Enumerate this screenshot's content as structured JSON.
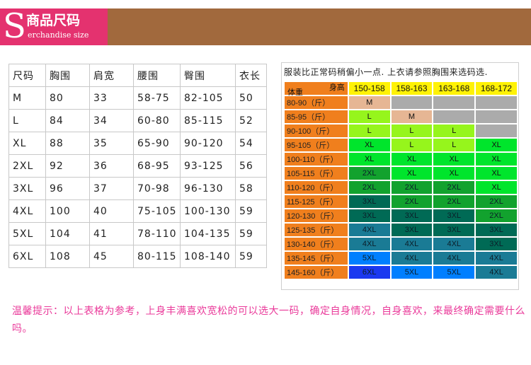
{
  "banner": {
    "letter": "S",
    "title_cn": "商品尺码",
    "title_en": "erchandise size"
  },
  "size_table": {
    "headers": [
      "尺码",
      "胸围",
      "肩宽",
      "腰围",
      "臀围",
      "衣长"
    ],
    "rows": [
      [
        "M",
        "80",
        "33",
        "58-75",
        "82-105",
        "50"
      ],
      [
        "L",
        "84",
        "34",
        "60-80",
        "85-115",
        "52"
      ],
      [
        "XL",
        "88",
        "35",
        "65-90",
        "90-120",
        "54"
      ],
      [
        "2XL",
        "92",
        "36",
        "68-95",
        "93-125",
        "56"
      ],
      [
        "3XL",
        "96",
        "37",
        "70-98",
        "96-130",
        "58"
      ],
      [
        "4XL",
        "100",
        "40",
        "75-105",
        "100-130",
        "59"
      ],
      [
        "5XL",
        "104",
        "41",
        "78-110",
        "104-135",
        "59"
      ],
      [
        "6XL",
        "108",
        "45",
        "80-115",
        "108-140",
        "59"
      ]
    ]
  },
  "recommend": {
    "title": "服装比正常码稍偏小一点. 上衣请参照胸围来选码选.",
    "corner_weight": "体重",
    "corner_height": "身高",
    "heights": [
      "150-158",
      "158-163",
      "163-168",
      "168-172"
    ],
    "rows": [
      {
        "weight": "80-90（斤）",
        "cells": [
          "M",
          "",
          "",
          ""
        ]
      },
      {
        "weight": "85-95（斤）",
        "cells": [
          "L",
          "M",
          "",
          ""
        ]
      },
      {
        "weight": "90-100（斤）",
        "cells": [
          "L",
          "L",
          "L",
          ""
        ]
      },
      {
        "weight": "95-105（斤）",
        "cells": [
          "XL",
          "L",
          "L",
          "XL"
        ]
      },
      {
        "weight": "100-110（斤）",
        "cells": [
          "XL",
          "XL",
          "XL",
          "XL"
        ]
      },
      {
        "weight": "105-115（斤）",
        "cells": [
          "2XL",
          "XL",
          "XL",
          "XL"
        ]
      },
      {
        "weight": "110-120（斤）",
        "cells": [
          "2XL",
          "2XL",
          "2XL",
          "XL"
        ]
      },
      {
        "weight": "115-125（斤）",
        "cells": [
          "3XL",
          "2XL",
          "2XL",
          "2XL"
        ]
      },
      {
        "weight": "120-130（斤）",
        "cells": [
          "3XL",
          "3XL",
          "3XL",
          "2XL"
        ]
      },
      {
        "weight": "125-135（斤）",
        "cells": [
          "4XL",
          "3XL",
          "3XL",
          "3XL"
        ]
      },
      {
        "weight": "130-140（斤）",
        "cells": [
          "4XL",
          "4XL",
          "4XL",
          "3XL"
        ]
      },
      {
        "weight": "135-145（斤）",
        "cells": [
          "5XL",
          "4XL",
          "4XL",
          "4XL"
        ]
      },
      {
        "weight": "145-160（斤）",
        "cells": [
          "6XL",
          "5XL",
          "5XL",
          "4XL"
        ]
      }
    ]
  },
  "colors": {
    "banner_brown": "#a1693d",
    "banner_red": "#e4326f",
    "weight_col": "#f07f1d",
    "header": "#fff205",
    "note": "#ea3a9a",
    "sizes": {
      "empty": "#ababab",
      "M": "#e6b694",
      "L": "#96f51c",
      "XL": "#00e52c",
      "2XL": "#12a22e",
      "3XL": "#006a55",
      "4XL": "#1a7b95",
      "5XL": "#007fff",
      "6XL": "#1b39f0"
    }
  },
  "note": "温馨提示：以上表格为参考，上身丰满喜欢宽松的可以选大一码，确定自身情况，自身喜欢，来最终确定需要什么吗。"
}
